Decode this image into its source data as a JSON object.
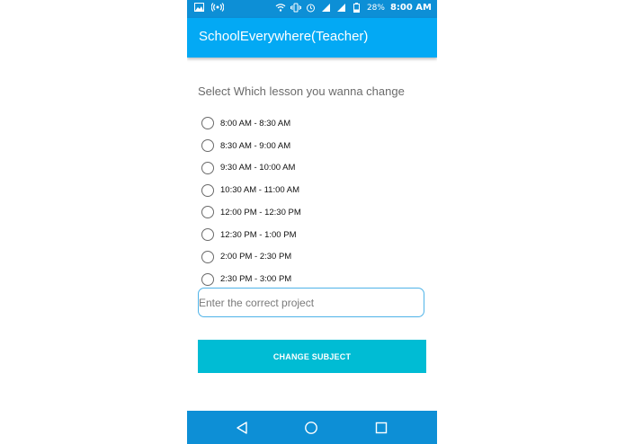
{
  "status_bar": {
    "time": "8:00 AM",
    "battery": "28%",
    "icons_left": [
      "image-icon",
      "hotspot-icon"
    ],
    "icons_right": [
      "wifi-icon",
      "vibrate-icon",
      "alarm-icon",
      "signal-3g-icon",
      "signal-icon",
      "battery-icon"
    ]
  },
  "app_bar": {
    "title": "SchoolEverywhere(Teacher)"
  },
  "lesson_form": {
    "prompt": "Select Which lesson you wanna change",
    "options": [
      "8:00 AM - 8:30 AM",
      "8:30 AM - 9:00 AM",
      "9:30 AM - 10:00 AM",
      "10:30 AM - 11:00 AM",
      "12:00 PM - 12:30 PM",
      "12:30 PM - 1:00 PM",
      "2:00 PM - 2:30 PM",
      "2:30 PM - 3:00 PM"
    ],
    "project_input": {
      "placeholder": "Enter the correct project",
      "value": ""
    },
    "submit_label": "CHANGE SUBJECT"
  },
  "nav_bar": {
    "buttons": [
      "back-icon",
      "home-icon",
      "recent-apps-icon"
    ]
  },
  "colors": {
    "status_bar": "#0d8fd6",
    "app_bar": "#03a9f4",
    "button": "#00bcd4",
    "input_border": "#4fb3e8"
  }
}
